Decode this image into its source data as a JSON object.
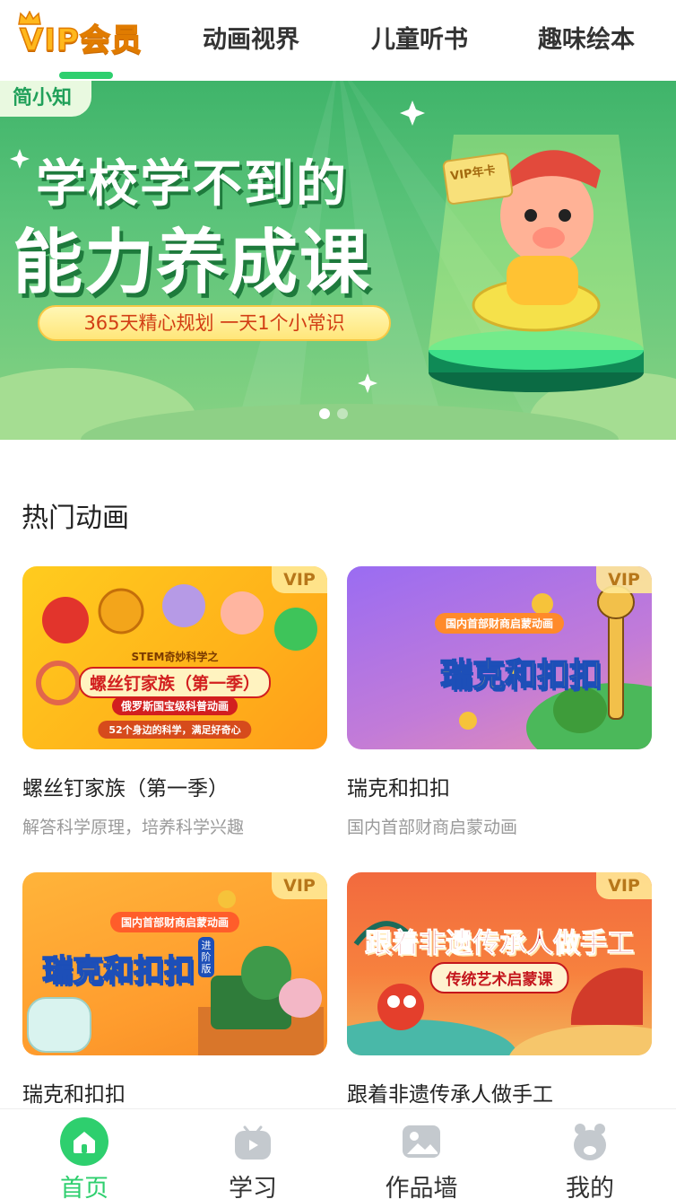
{
  "top_tabs": {
    "vip_label": "VIP会员",
    "tabs": [
      "动画视界",
      "儿童听书",
      "趣味绘本"
    ]
  },
  "banner": {
    "brand_tag": "简小知",
    "headline_line1": "学校学不到的",
    "headline_line2": "能力养成课",
    "subline": "365天精心规划  一天1个小常识",
    "card_text": "VIP年卡"
  },
  "section": {
    "title": "热门动画"
  },
  "cards": [
    {
      "title": "螺丝钉家族（第一季）",
      "subtitle": "解答科学原理，培养科学兴趣",
      "badge": "VIP",
      "art_top": "STEM奇妙科学之",
      "art_main": "螺丝钉家族（第一季）",
      "art_sub": "俄罗斯国宝级科普动画",
      "art_note": "52个身边的科学，满足好奇心"
    },
    {
      "title": "瑞克和扣扣",
      "subtitle": "国内首部财商启蒙动画",
      "badge": "VIP",
      "art_top": "国内首部财商启蒙动画",
      "art_main": "瑞克和扣扣"
    },
    {
      "title": "瑞克和扣扣",
      "subtitle": "",
      "badge": "VIP",
      "art_top": "国内首部财商启蒙动画",
      "art_main": "瑞克和扣扣",
      "art_tag": "进阶版"
    },
    {
      "title": "跟着非遗传承人做手工",
      "subtitle": "",
      "badge": "VIP",
      "art_main": "跟着非遗传承人做手工",
      "art_sub": "传统艺术启蒙课"
    }
  ],
  "bottom_nav": {
    "items": [
      {
        "label": "首页",
        "icon": "home-icon",
        "active": true
      },
      {
        "label": "学习",
        "icon": "tv-icon",
        "active": false
      },
      {
        "label": "作品墙",
        "icon": "picture-icon",
        "active": false
      },
      {
        "label": "我的",
        "icon": "profile-icon",
        "active": false
      }
    ]
  },
  "colors": {
    "accent": "#2ecf6e",
    "vip_gold": "#ffb81c"
  }
}
